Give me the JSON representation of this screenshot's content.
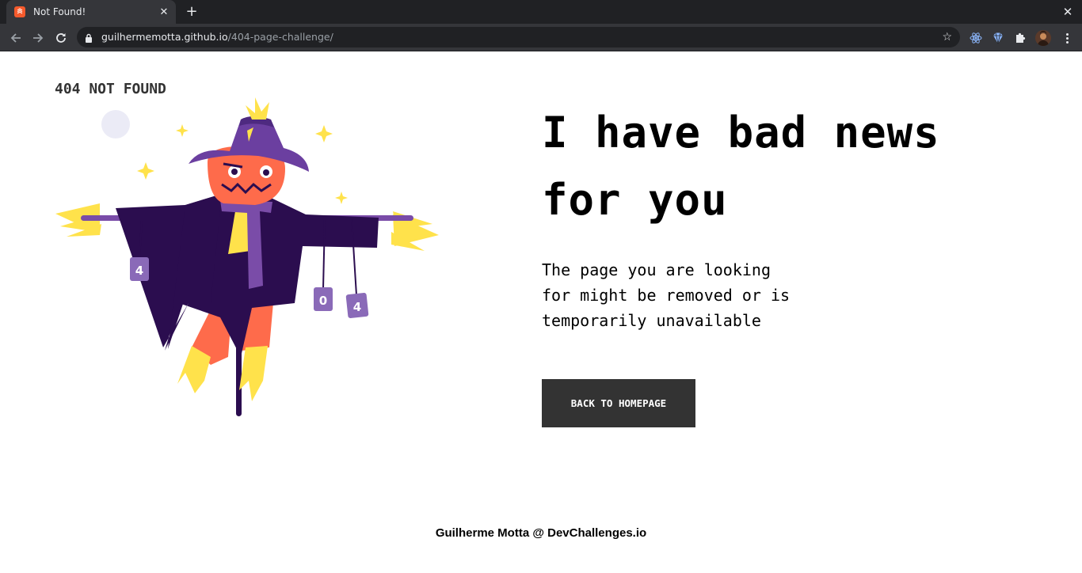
{
  "browser": {
    "tab_title": "Not Found!",
    "url_host": "guilhermemotta.github.io",
    "url_path": "/404-page-challenge/",
    "icons": [
      "back-icon",
      "forward-icon",
      "reload-icon",
      "lock-icon",
      "star-icon",
      "react-devtools-icon",
      "gem-icon",
      "extensions-puzzle-icon",
      "profile-avatar",
      "menu-dots-icon"
    ]
  },
  "page": {
    "brand": "404 NOT FOUND",
    "headline_line1": "I have bad news",
    "headline_line2": "for you",
    "message_line1": "The page you are looking",
    "message_line2": "for might be removed or is",
    "message_line3": "temporarily unavailable",
    "button_label": "BACK TO HOMEPAGE",
    "footer": "Guilherme Motta @ DevChallenges.io",
    "illustration": {
      "subject": "scarecrow",
      "can_digits": [
        "4",
        "0",
        "4"
      ]
    }
  },
  "colors": {
    "chrome_dark": "#202124",
    "chrome_tab": "#35363a",
    "button_bg": "#333333",
    "scarecrow_purple": "#2b0d4f",
    "hat_purple": "#6b3fa0",
    "pumpkin_orange": "#fe6b4b",
    "straw_yellow": "#ffe24b"
  }
}
